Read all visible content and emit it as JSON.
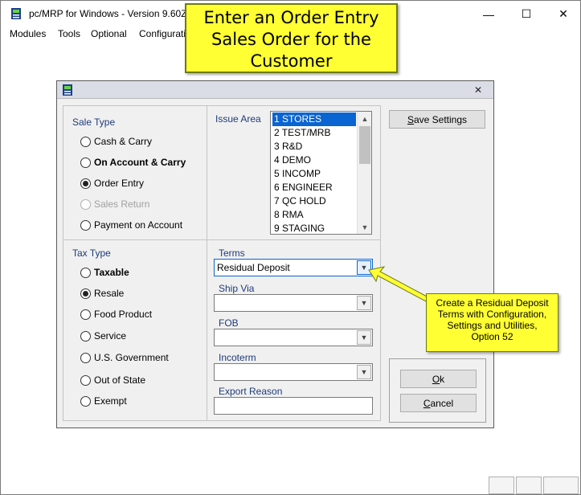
{
  "app": {
    "title": "pc/MRP for Windows - Version 9.60Z",
    "window_controls": {
      "minimize": "—",
      "maximize": "☐",
      "close": "✕"
    }
  },
  "menu": {
    "items": [
      {
        "label": "Modules"
      },
      {
        "label": "Tools"
      },
      {
        "label": "Optional"
      },
      {
        "label": "Configurati"
      }
    ]
  },
  "callout_top": {
    "lines": [
      "Enter an Order Entry",
      "Sales Order for the",
      "Customer"
    ],
    "color": "#ffff33"
  },
  "dialog": {
    "close_glyph": "✕",
    "sale_type": {
      "label": "Sale Type",
      "options": [
        {
          "label": "Cash & Carry",
          "checked": false,
          "disabled": false,
          "bold": false
        },
        {
          "label": "On Account & Carry",
          "checked": false,
          "disabled": false,
          "bold": true
        },
        {
          "label": "Order Entry",
          "checked": true,
          "disabled": false,
          "bold": false
        },
        {
          "label": "Sales Return",
          "checked": false,
          "disabled": true,
          "bold": false
        },
        {
          "label": "Payment on Account",
          "checked": false,
          "disabled": false,
          "bold": false
        }
      ]
    },
    "tax_type": {
      "label": "Tax Type",
      "options": [
        {
          "label": "Taxable",
          "checked": false,
          "bold": true
        },
        {
          "label": "Resale",
          "checked": true,
          "bold": false
        },
        {
          "label": "Food Product",
          "checked": false,
          "bold": false
        },
        {
          "label": "Service",
          "checked": false,
          "bold": false
        },
        {
          "label": "U.S. Government",
          "checked": false,
          "bold": false
        },
        {
          "label": "Out of State",
          "checked": false,
          "bold": false
        },
        {
          "label": "Exempt",
          "checked": false,
          "bold": false
        }
      ]
    },
    "issue_area": {
      "label": "Issue Area",
      "items": [
        "1  STORES",
        "2  TEST/MRB",
        "3  R&D",
        "4  DEMO",
        "5  INCOMP",
        "6  ENGINEER",
        "7  QC HOLD",
        "8  RMA",
        "9  STAGING"
      ],
      "selected_index": 0
    },
    "terms": {
      "label": "Terms",
      "value": "Residual Deposit"
    },
    "ship_via": {
      "label": "Ship Via",
      "value": ""
    },
    "fob": {
      "label": "FOB",
      "value": ""
    },
    "incoterm": {
      "label": "Incoterm",
      "value": ""
    },
    "export_reason": {
      "label": "Export Reason",
      "value": ""
    },
    "buttons": {
      "save_settings_u": "S",
      "save_settings_rest": "ave Settings",
      "ok_u": "O",
      "ok_rest": "k",
      "cancel_u": "C",
      "cancel_rest": "ancel"
    }
  },
  "callout_side": {
    "lines": [
      "Create a Residual Deposit",
      "Terms with Configuration,",
      "Settings and Utilities,",
      "Option 52"
    ],
    "color": "#ffff33"
  },
  "icons": {
    "app": "app-printer-icon",
    "dialog": "dialog-printer-icon",
    "arrow": "callout-arrow"
  }
}
